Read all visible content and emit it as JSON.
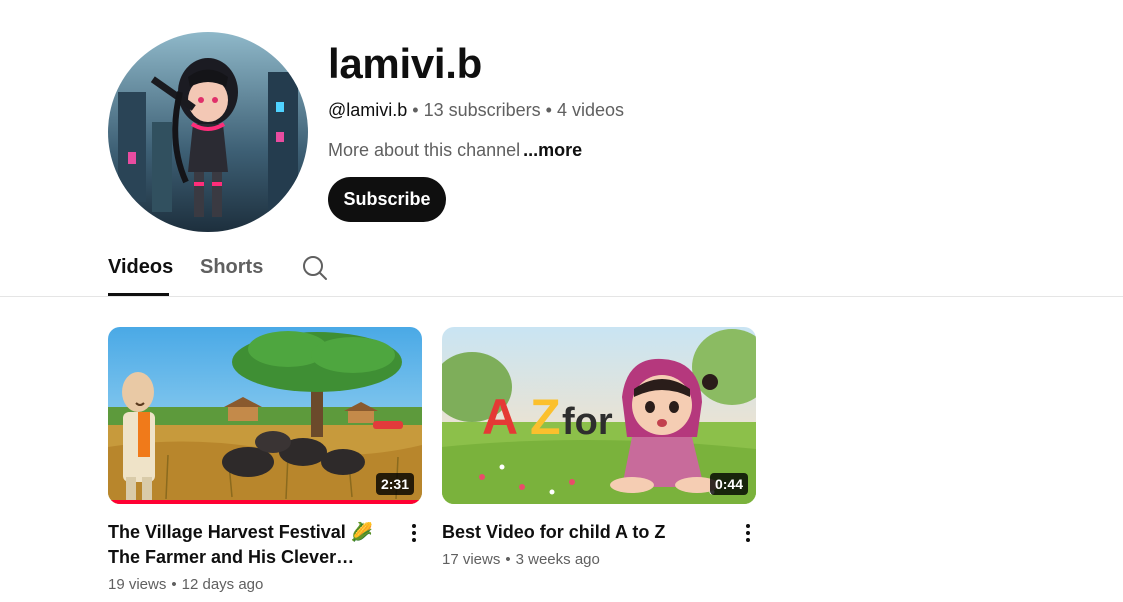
{
  "channel": {
    "name": "lamivi.b",
    "handle": "@lamivi.b",
    "subscribers": "13 subscribers",
    "video_count": "4 videos",
    "separator": "•",
    "about_text": "More about this channel",
    "more_label": "...more",
    "subscribe_label": "Subscribe"
  },
  "tabs": {
    "videos": "Videos",
    "shorts": "Shorts",
    "active": "Videos"
  },
  "videos": [
    {
      "title": "The Village Harvest Festival 🌽 The Farmer and His Clever Tractor 🚜 …",
      "duration": "2:31",
      "views": "19 views",
      "age": "12 days ago",
      "watched_fraction": 1.0
    },
    {
      "title": "Best Video for child A to Z",
      "duration": "0:44",
      "views": "17 views",
      "age": "3 weeks ago",
      "thumbnail_text": [
        "A",
        "Z",
        "for"
      ],
      "watched_fraction": 0
    }
  ],
  "colors": {
    "subscribe_bg": "#0f0f0f",
    "secondary_text": "#606060",
    "progress": "#ff0033"
  },
  "icons": [
    "search-icon",
    "more-vert-icon"
  ]
}
